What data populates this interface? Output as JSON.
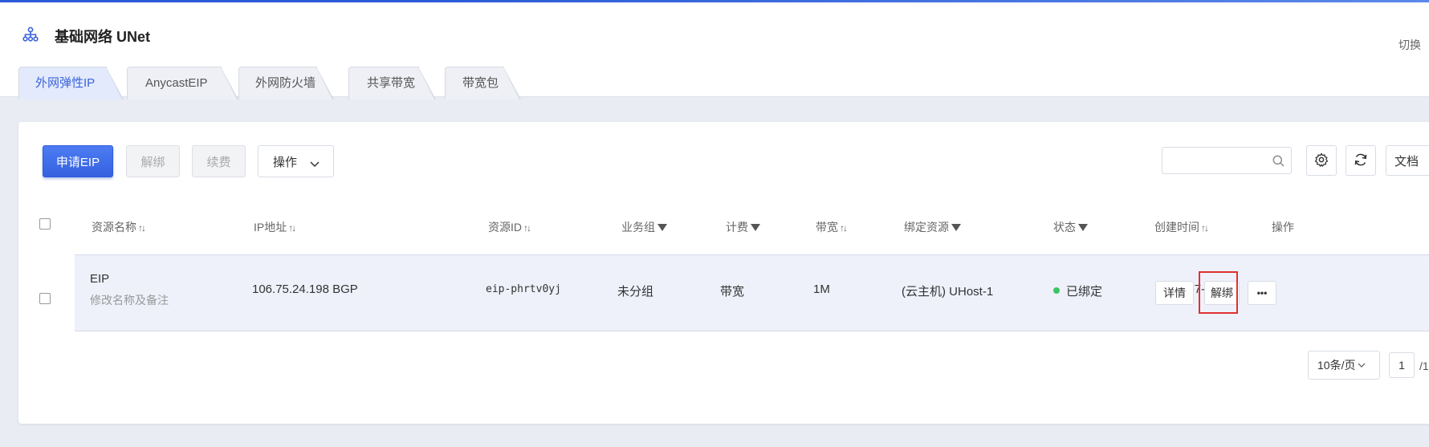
{
  "header": {
    "title": "基础网络 UNet",
    "switch_link": "切换"
  },
  "tabs": [
    {
      "label": "外网弹性IP",
      "active": true
    },
    {
      "label": "AnycastEIP",
      "active": false
    },
    {
      "label": "外网防火墙",
      "active": false
    },
    {
      "label": "共享带宽",
      "active": false
    },
    {
      "label": "带宽包",
      "active": false
    }
  ],
  "toolbar": {
    "apply_label": "申请EIP",
    "unbind_label": "解绑",
    "renew_label": "续费",
    "operate_label": "操作",
    "search_placeholder": "",
    "docs_label": "文档"
  },
  "table": {
    "columns": {
      "name": "资源名称",
      "ip": "IP地址",
      "resource_id": "资源ID",
      "group": "业务组",
      "billing": "计费",
      "bandwidth": "带宽",
      "bound_resource": "绑定资源",
      "status": "状态",
      "created": "创建时间",
      "actions": "操作"
    },
    "rows": [
      {
        "name": "EIP",
        "name_hint": "修改名称及备注",
        "ip": "106.75.24.198 BGP",
        "resource_id": "eip-phrtv0yj",
        "group": "未分组",
        "billing": "带宽",
        "bandwidth": "1M",
        "bound_resource": "(云主机) UHost-1",
        "status": "已绑定",
        "created": "2020-07-20",
        "detail_label": "详情",
        "unbind_label": "解绑",
        "more_label": "•••"
      }
    ]
  },
  "pagination": {
    "page_size": "10条/页",
    "current_page": "1",
    "total": "/1"
  },
  "colors": {
    "primary": "#3a63d8",
    "status_ok": "#3cc464",
    "highlight": "#e03030"
  }
}
